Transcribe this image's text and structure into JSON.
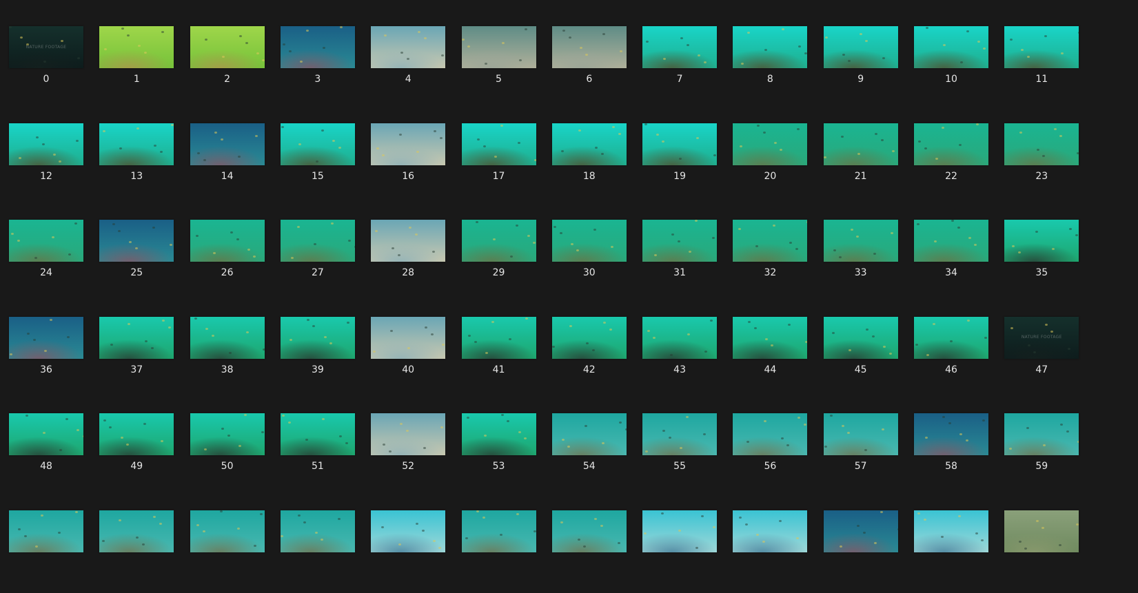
{
  "explorer": {
    "view": "large-icons",
    "watermark_text": "NATURE FOOTAGE",
    "items": [
      {
        "name": "0",
        "style": "dark"
      },
      {
        "name": "1",
        "style": "lime"
      },
      {
        "name": "2",
        "style": "lime"
      },
      {
        "name": "3",
        "style": "blue-reef"
      },
      {
        "name": "4",
        "style": "fish-school"
      },
      {
        "name": "5",
        "style": "grey-school"
      },
      {
        "name": "6",
        "style": "grey-school"
      },
      {
        "name": "7",
        "style": "bright-reef"
      },
      {
        "name": "8",
        "style": "bright-reef"
      },
      {
        "name": "9",
        "style": "bright-reef"
      },
      {
        "name": "10",
        "style": "bright-reef"
      },
      {
        "name": "11",
        "style": "bright-reef"
      },
      {
        "name": "12",
        "style": "bright-reef"
      },
      {
        "name": "13",
        "style": "bright-reef"
      },
      {
        "name": "14",
        "style": "blue-reef"
      },
      {
        "name": "15",
        "style": "bright-reef"
      },
      {
        "name": "16",
        "style": "fish-school"
      },
      {
        "name": "17",
        "style": "bright-reef"
      },
      {
        "name": "18",
        "style": "bright-reef"
      },
      {
        "name": "19",
        "style": "bright-reef"
      },
      {
        "name": "20",
        "style": "sand-green"
      },
      {
        "name": "21",
        "style": "sand-green"
      },
      {
        "name": "22",
        "style": "sand-green"
      },
      {
        "name": "23",
        "style": "sand-green"
      },
      {
        "name": "24",
        "style": "sand-green"
      },
      {
        "name": "25",
        "style": "blue-reef"
      },
      {
        "name": "26",
        "style": "sand-green"
      },
      {
        "name": "27",
        "style": "sand-green"
      },
      {
        "name": "28",
        "style": "fish-school"
      },
      {
        "name": "29",
        "style": "sand-green"
      },
      {
        "name": "30",
        "style": "sand-green"
      },
      {
        "name": "31",
        "style": "sand-green"
      },
      {
        "name": "32",
        "style": "sand-green"
      },
      {
        "name": "33",
        "style": "sand-green"
      },
      {
        "name": "34",
        "style": "sand-green"
      },
      {
        "name": "35",
        "style": "green-rock"
      },
      {
        "name": "36",
        "style": "blue-reef"
      },
      {
        "name": "37",
        "style": "green-rock"
      },
      {
        "name": "38",
        "style": "green-rock"
      },
      {
        "name": "39",
        "style": "green-rock"
      },
      {
        "name": "40",
        "style": "fish-school"
      },
      {
        "name": "41",
        "style": "green-rock"
      },
      {
        "name": "42",
        "style": "green-rock"
      },
      {
        "name": "43",
        "style": "green-rock"
      },
      {
        "name": "44",
        "style": "green-rock"
      },
      {
        "name": "45",
        "style": "green-rock"
      },
      {
        "name": "46",
        "style": "green-rock"
      },
      {
        "name": "47",
        "style": "dark"
      },
      {
        "name": "48",
        "style": "green-rock"
      },
      {
        "name": "49",
        "style": "green-rock"
      },
      {
        "name": "50",
        "style": "green-rock"
      },
      {
        "name": "51",
        "style": "green-rock"
      },
      {
        "name": "52",
        "style": "fish-school"
      },
      {
        "name": "53",
        "style": "green-rock"
      },
      {
        "name": "54",
        "style": "teal-sand"
      },
      {
        "name": "55",
        "style": "teal-sand"
      },
      {
        "name": "56",
        "style": "teal-sand"
      },
      {
        "name": "57",
        "style": "teal-sand"
      },
      {
        "name": "58",
        "style": "blue-reef"
      },
      {
        "name": "59",
        "style": "teal-sand"
      },
      {
        "style": "teal-sand"
      },
      {
        "style": "teal-sand"
      },
      {
        "style": "teal-sand"
      },
      {
        "style": "teal-sand"
      },
      {
        "style": "bright-fish"
      },
      {
        "style": "teal-sand"
      },
      {
        "style": "teal-sand"
      },
      {
        "style": "bright-fish"
      },
      {
        "style": "bright-fish"
      },
      {
        "style": "blue-reef"
      },
      {
        "style": "bright-fish"
      },
      {
        "style": "olive-rock"
      }
    ]
  },
  "palette": {
    "dark": {
      "top": "#15302c",
      "bottom": "#0d1c1c",
      "reef": "#14201f"
    },
    "lime": {
      "top": "#9fd64a",
      "bottom": "#76c23a",
      "reef": "#a89a4a"
    },
    "blue-reef": {
      "top": "#1a5f86",
      "bottom": "#2a8a94",
      "reef": "#7a5a6a"
    },
    "fish-school": {
      "top": "#6aa6b5",
      "bottom": "#c8c8b0",
      "reef": "#8fb2b8"
    },
    "grey-school": {
      "top": "#5e8c86",
      "bottom": "#b0b09a",
      "reef": "#9aa598"
    },
    "bright-reef": {
      "top": "#19d5c8",
      "bottom": "#1fae8e",
      "reef": "#4a5a3a"
    },
    "sand-green": {
      "top": "#1ab592",
      "bottom": "#2aa87a",
      "reef": "#5f7a4d"
    },
    "green-rock": {
      "top": "#19c9ad",
      "bottom": "#1ea66e",
      "reef": "#27473a"
    },
    "teal-sand": {
      "top": "#1ea7a0",
      "bottom": "#4ab8b0",
      "reef": "#6a7a5a"
    },
    "bright-fish": {
      "top": "#3ac3d3",
      "bottom": "#9fd8d8",
      "reef": "#4d86a0"
    },
    "olive-rock": {
      "top": "#8aa07a",
      "bottom": "#6f8a5f",
      "reef": "#8a9a6e"
    }
  }
}
